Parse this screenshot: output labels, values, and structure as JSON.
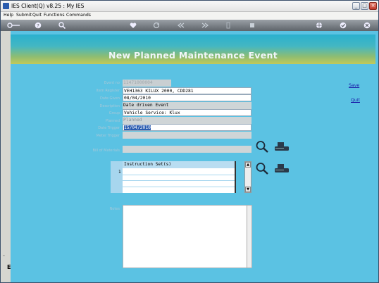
{
  "window": {
    "title": "IES Client(Q) v8.25 : My IES",
    "controls": {
      "minimize": "_",
      "maximize": "□",
      "close": "×"
    }
  },
  "menu": {
    "items": [
      "Help",
      "Submit",
      "Quit",
      "Functions",
      "Commands"
    ]
  },
  "toolbar": {
    "icons": [
      "key-icon",
      "help-icon",
      "search-icon",
      "heart-icon",
      "refresh-icon",
      "rewind-icon",
      "fast-forward-icon",
      "info-icon",
      "stop-icon",
      "globe-icon",
      "check-icon",
      "close-icon"
    ]
  },
  "form": {
    "title": "New Planned Maintenance Event",
    "labels": {
      "event_no": "Event no",
      "item_register": "Item Register",
      "date_given": "Date Given",
      "description": "Description",
      "group": "Group",
      "planned": "Planned",
      "date_trigger": "Date Trigger",
      "meter_trigger": "Meter Trigger",
      "bill_of_materials": "Bill of Materials",
      "notes": "Notes"
    },
    "values": {
      "event_no": "11471000004",
      "item_register": "VEH1363 KILUX 2000, CDD281",
      "date_given": "08/04/2010",
      "description": "Date driven Event",
      "group": "Vehicle Service: Klux",
      "planned": "Planned",
      "date_trigger": "15/04/2010",
      "meter_trigger": "",
      "bill_of_materials": "",
      "notes": ""
    },
    "instruction_sets": {
      "header": "Instruction Set(s)",
      "row_number": "1",
      "scroll_up": "▲",
      "scroll_down": "▼"
    },
    "actions": {
      "save": "Save",
      "quit": "Quit"
    }
  },
  "colors": {
    "background": "#5bc2e3",
    "banner_top": "#2ab0cf",
    "banner_bottom": "#c2c95a",
    "toolbar": "#6e747a",
    "link": "#1a1aa8"
  }
}
